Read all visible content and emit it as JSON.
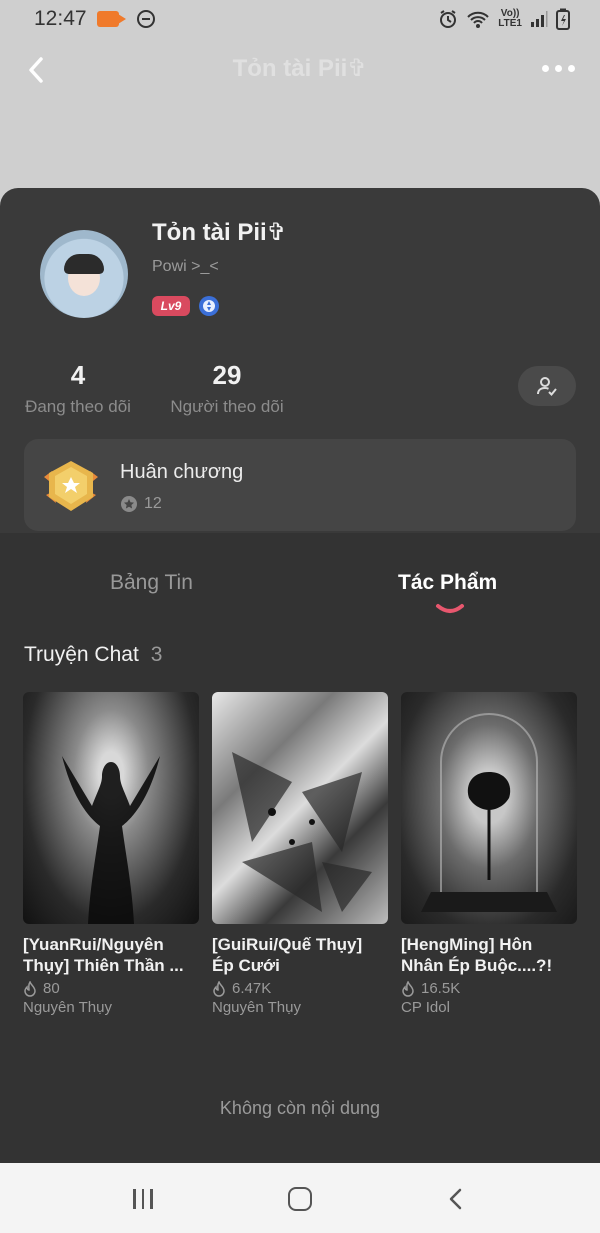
{
  "status_bar": {
    "time": "12:47",
    "network_label_top": "Vo))",
    "network_label_bottom": "LTE1"
  },
  "header": {
    "title": "Tỏn tài Pii✞"
  },
  "profile": {
    "name": "Tỏn tài Pii✞",
    "bio": "Powi >_<",
    "level": "Lv9"
  },
  "stats": {
    "following_count": "4",
    "following_label": "Đang theo dõi",
    "followers_count": "29",
    "followers_label": "Người theo dõi"
  },
  "medals": {
    "title": "Huân chương",
    "count": "12"
  },
  "tabs": {
    "news": "Bảng Tin",
    "works": "Tác Phẩm"
  },
  "section": {
    "title": "Truyện Chat",
    "count": "3"
  },
  "stories": [
    {
      "title": "[YuanRui/Nguyên Thụy] Thiên Thần ...",
      "views": "80",
      "author": "Nguyên Thụy"
    },
    {
      "title": "[GuiRui/Quế Thụy] Ép Cưới",
      "views": "6.47K",
      "author": "Nguyên Thụy"
    },
    {
      "title": "[HengMing] Hôn Nhân Ép Buộc....?!",
      "views": "16.5K",
      "author": "CP Idol"
    }
  ],
  "footer": {
    "end_text": "Không còn nội dung"
  },
  "colors": {
    "accent": "#d94a5f",
    "sheet_bg": "#3a3a3a",
    "content_bg": "#333333"
  }
}
